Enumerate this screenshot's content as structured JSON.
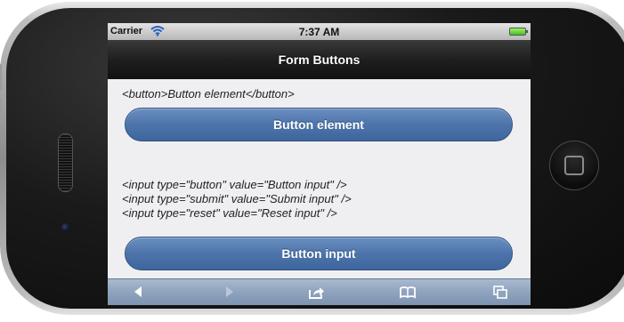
{
  "statusbar": {
    "carrier": "Carrier",
    "time": "7:37 AM"
  },
  "navbar": {
    "title": "Form Buttons"
  },
  "content": {
    "button_snippet": "<button>Button element</button>",
    "button_element_label": "Button element",
    "input_snippets": [
      "<input type=\"button\" value=\"Button input\" />",
      "<input type=\"submit\" value=\"Submit input\" />",
      "<input type=\"reset\" value=\"Reset input\" />"
    ],
    "button_input_label": "Button input"
  },
  "toolbar": {
    "icons": [
      "back-arrow-icon",
      "forward-arrow-icon",
      "share-icon",
      "bookmarks-icon",
      "tabs-icon"
    ]
  },
  "colors": {
    "button_blue": "#4d74aa",
    "navbar_black": "#1f1f1f",
    "toolbar_blue": "#8ea3be",
    "battery_green": "#46c021"
  }
}
